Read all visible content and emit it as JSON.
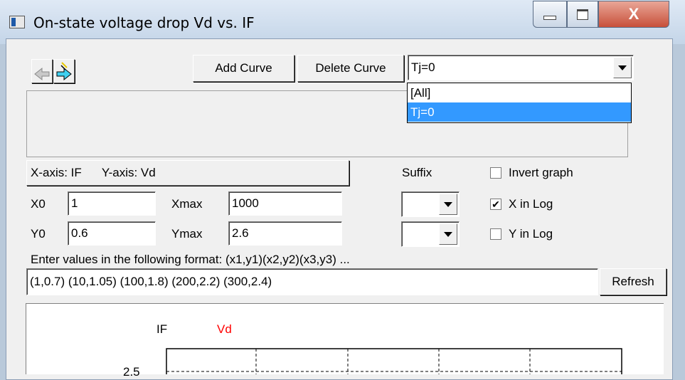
{
  "window": {
    "title": "On-state voltage drop Vd vs. IF",
    "min_label": "–",
    "max_label": "□",
    "close_label": "X"
  },
  "toolbar": {
    "add_curve": "Add Curve",
    "delete_curve": "Delete Curve",
    "curve_select": "Tj=0",
    "curve_options": [
      "[All]",
      "Tj=0"
    ],
    "selected_option": "Tj=0"
  },
  "axes": {
    "info": "X-axis: IF      Y-axis: Vd",
    "suffix_label": "Suffix",
    "invert_graph": "Invert graph",
    "invert_checked": false,
    "x_in_log": "X in Log",
    "x_log_checked": true,
    "y_in_log": "Y in Log",
    "y_log_checked": false
  },
  "fields": {
    "x0_label": "X0",
    "x0_value": "1",
    "xmax_label": "Xmax",
    "xmax_value": "1000",
    "y0_label": "Y0",
    "y0_value": "0.6",
    "ymax_label": "Ymax",
    "ymax_value": "2.6"
  },
  "values": {
    "instruction": "Enter values in the following format:  (x1,y1)(x2,y2)(x3,y3) ...",
    "input": "(1,0.7) (10,1.05) (100,1.8) (200,2.2) (300,2.4)",
    "refresh": "Refresh"
  },
  "graph": {
    "x_name": "IF",
    "y_name": "Vd",
    "y_name_color": "#ff0000",
    "tick_label": "2.5"
  }
}
